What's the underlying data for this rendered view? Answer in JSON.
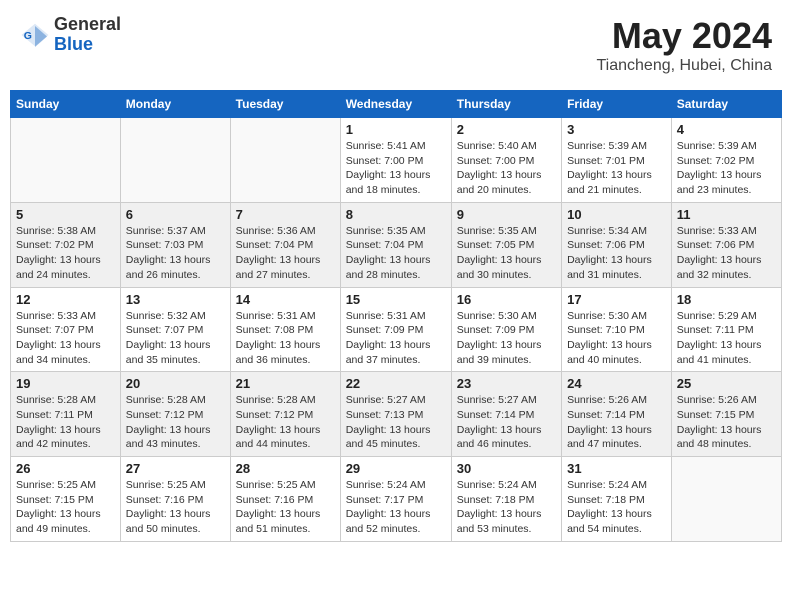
{
  "header": {
    "logo_general": "General",
    "logo_blue": "Blue",
    "month_year": "May 2024",
    "location": "Tiancheng, Hubei, China"
  },
  "weekdays": [
    "Sunday",
    "Monday",
    "Tuesday",
    "Wednesday",
    "Thursday",
    "Friday",
    "Saturday"
  ],
  "weeks": [
    [
      {
        "day": "",
        "info": ""
      },
      {
        "day": "",
        "info": ""
      },
      {
        "day": "",
        "info": ""
      },
      {
        "day": "1",
        "info": "Sunrise: 5:41 AM\nSunset: 7:00 PM\nDaylight: 13 hours\nand 18 minutes."
      },
      {
        "day": "2",
        "info": "Sunrise: 5:40 AM\nSunset: 7:00 PM\nDaylight: 13 hours\nand 20 minutes."
      },
      {
        "day": "3",
        "info": "Sunrise: 5:39 AM\nSunset: 7:01 PM\nDaylight: 13 hours\nand 21 minutes."
      },
      {
        "day": "4",
        "info": "Sunrise: 5:39 AM\nSunset: 7:02 PM\nDaylight: 13 hours\nand 23 minutes."
      }
    ],
    [
      {
        "day": "5",
        "info": "Sunrise: 5:38 AM\nSunset: 7:02 PM\nDaylight: 13 hours\nand 24 minutes."
      },
      {
        "day": "6",
        "info": "Sunrise: 5:37 AM\nSunset: 7:03 PM\nDaylight: 13 hours\nand 26 minutes."
      },
      {
        "day": "7",
        "info": "Sunrise: 5:36 AM\nSunset: 7:04 PM\nDaylight: 13 hours\nand 27 minutes."
      },
      {
        "day": "8",
        "info": "Sunrise: 5:35 AM\nSunset: 7:04 PM\nDaylight: 13 hours\nand 28 minutes."
      },
      {
        "day": "9",
        "info": "Sunrise: 5:35 AM\nSunset: 7:05 PM\nDaylight: 13 hours\nand 30 minutes."
      },
      {
        "day": "10",
        "info": "Sunrise: 5:34 AM\nSunset: 7:06 PM\nDaylight: 13 hours\nand 31 minutes."
      },
      {
        "day": "11",
        "info": "Sunrise: 5:33 AM\nSunset: 7:06 PM\nDaylight: 13 hours\nand 32 minutes."
      }
    ],
    [
      {
        "day": "12",
        "info": "Sunrise: 5:33 AM\nSunset: 7:07 PM\nDaylight: 13 hours\nand 34 minutes."
      },
      {
        "day": "13",
        "info": "Sunrise: 5:32 AM\nSunset: 7:07 PM\nDaylight: 13 hours\nand 35 minutes."
      },
      {
        "day": "14",
        "info": "Sunrise: 5:31 AM\nSunset: 7:08 PM\nDaylight: 13 hours\nand 36 minutes."
      },
      {
        "day": "15",
        "info": "Sunrise: 5:31 AM\nSunset: 7:09 PM\nDaylight: 13 hours\nand 37 minutes."
      },
      {
        "day": "16",
        "info": "Sunrise: 5:30 AM\nSunset: 7:09 PM\nDaylight: 13 hours\nand 39 minutes."
      },
      {
        "day": "17",
        "info": "Sunrise: 5:30 AM\nSunset: 7:10 PM\nDaylight: 13 hours\nand 40 minutes."
      },
      {
        "day": "18",
        "info": "Sunrise: 5:29 AM\nSunset: 7:11 PM\nDaylight: 13 hours\nand 41 minutes."
      }
    ],
    [
      {
        "day": "19",
        "info": "Sunrise: 5:28 AM\nSunset: 7:11 PM\nDaylight: 13 hours\nand 42 minutes."
      },
      {
        "day": "20",
        "info": "Sunrise: 5:28 AM\nSunset: 7:12 PM\nDaylight: 13 hours\nand 43 minutes."
      },
      {
        "day": "21",
        "info": "Sunrise: 5:28 AM\nSunset: 7:12 PM\nDaylight: 13 hours\nand 44 minutes."
      },
      {
        "day": "22",
        "info": "Sunrise: 5:27 AM\nSunset: 7:13 PM\nDaylight: 13 hours\nand 45 minutes."
      },
      {
        "day": "23",
        "info": "Sunrise: 5:27 AM\nSunset: 7:14 PM\nDaylight: 13 hours\nand 46 minutes."
      },
      {
        "day": "24",
        "info": "Sunrise: 5:26 AM\nSunset: 7:14 PM\nDaylight: 13 hours\nand 47 minutes."
      },
      {
        "day": "25",
        "info": "Sunrise: 5:26 AM\nSunset: 7:15 PM\nDaylight: 13 hours\nand 48 minutes."
      }
    ],
    [
      {
        "day": "26",
        "info": "Sunrise: 5:25 AM\nSunset: 7:15 PM\nDaylight: 13 hours\nand 49 minutes."
      },
      {
        "day": "27",
        "info": "Sunrise: 5:25 AM\nSunset: 7:16 PM\nDaylight: 13 hours\nand 50 minutes."
      },
      {
        "day": "28",
        "info": "Sunrise: 5:25 AM\nSunset: 7:16 PM\nDaylight: 13 hours\nand 51 minutes."
      },
      {
        "day": "29",
        "info": "Sunrise: 5:24 AM\nSunset: 7:17 PM\nDaylight: 13 hours\nand 52 minutes."
      },
      {
        "day": "30",
        "info": "Sunrise: 5:24 AM\nSunset: 7:18 PM\nDaylight: 13 hours\nand 53 minutes."
      },
      {
        "day": "31",
        "info": "Sunrise: 5:24 AM\nSunset: 7:18 PM\nDaylight: 13 hours\nand 54 minutes."
      },
      {
        "day": "",
        "info": ""
      }
    ]
  ]
}
